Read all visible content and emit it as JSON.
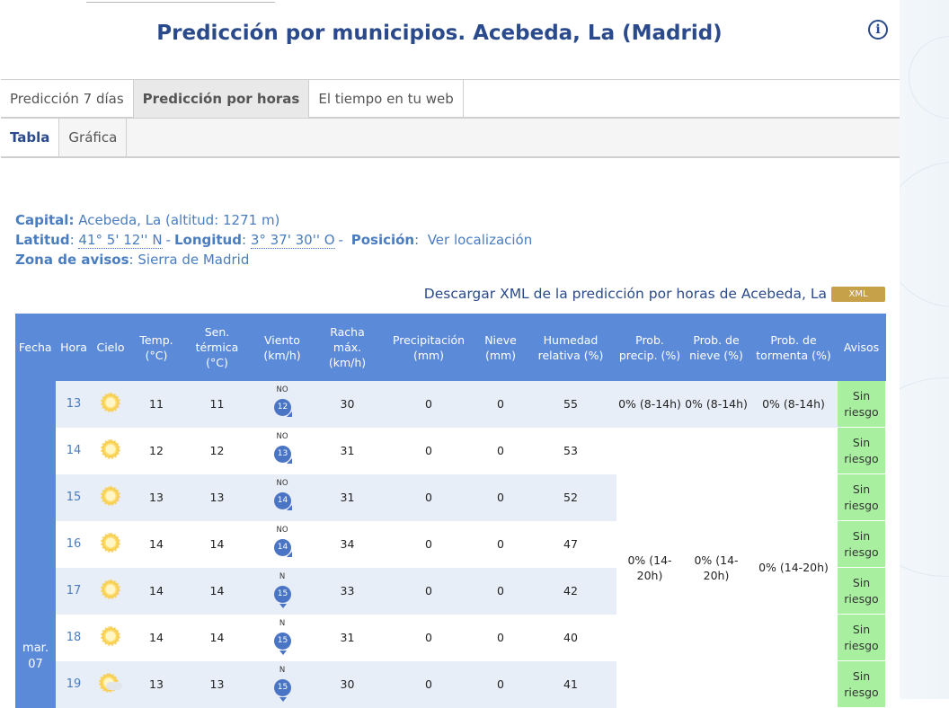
{
  "header": {
    "title": "Predicción por municipios. Acebeda, La (Madrid)"
  },
  "tabs": [
    "Predicción 7 días",
    "Predicción por horas",
    "El tiempo en tu web"
  ],
  "subtabs": [
    "Tabla",
    "Gráfica"
  ],
  "info": {
    "capital_label": "Capital:",
    "capital_value": " Acebeda, La (altitud: 1271 m)",
    "latitud_label": "Latitud",
    "latitud_value": "41° 5' 12'' N",
    "longitud_label": "Longitud",
    "longitud_value": "3° 37' 30'' O",
    "posicion_label": "Posición",
    "posicion_link": "Ver localización",
    "zona_label": "Zona de avisos",
    "zona_value": "Sierra de Madrid"
  },
  "download": {
    "text": "Descargar XML de la predicción por horas de Acebeda, La",
    "badge": "XML"
  },
  "table": {
    "headers": {
      "fecha": "Fecha",
      "hora": "Hora",
      "cielo": "Cielo",
      "temp": "Temp. (°C)",
      "sen": "Sen. térmica (°C)",
      "viento": "Viento (km/h)",
      "racha": "Racha máx. (km/h)",
      "precip": "Precipitación (mm)",
      "nieve": "Nieve (mm)",
      "humedad": "Humedad relativa (%)",
      "prob_precip": "Prob. precip. (%)",
      "prob_nieve": "Prob. de nieve (%)",
      "prob_tormenta": "Prob. de tormenta (%)",
      "avisos": "Avisos"
    },
    "fecha": "mar. 07",
    "rows": [
      {
        "hora": "13",
        "cielo": "sun-icon",
        "temp": "11",
        "sen": "11",
        "wind_dir": "NO",
        "wind_speed": "12",
        "racha": "30",
        "precip": "0",
        "nieve": "0",
        "humedad": "55",
        "aviso": "Sin riesgo"
      },
      {
        "hora": "14",
        "cielo": "sun-icon",
        "temp": "12",
        "sen": "12",
        "wind_dir": "NO",
        "wind_speed": "13",
        "racha": "31",
        "precip": "0",
        "nieve": "0",
        "humedad": "53",
        "aviso": "Sin riesgo"
      },
      {
        "hora": "15",
        "cielo": "sun-icon",
        "temp": "13",
        "sen": "13",
        "wind_dir": "NO",
        "wind_speed": "14",
        "racha": "31",
        "precip": "0",
        "nieve": "0",
        "humedad": "52",
        "aviso": "Sin riesgo"
      },
      {
        "hora": "16",
        "cielo": "sun-icon",
        "temp": "14",
        "sen": "14",
        "wind_dir": "NO",
        "wind_speed": "14",
        "racha": "34",
        "precip": "0",
        "nieve": "0",
        "humedad": "47",
        "aviso": "Sin riesgo"
      },
      {
        "hora": "17",
        "cielo": "sun-icon",
        "temp": "14",
        "sen": "14",
        "wind_dir": "N",
        "wind_speed": "15",
        "racha": "33",
        "precip": "0",
        "nieve": "0",
        "humedad": "42",
        "aviso": "Sin riesgo"
      },
      {
        "hora": "18",
        "cielo": "sun-icon",
        "temp": "14",
        "sen": "14",
        "wind_dir": "N",
        "wind_speed": "15",
        "racha": "31",
        "precip": "0",
        "nieve": "0",
        "humedad": "40",
        "aviso": "Sin riesgo"
      },
      {
        "hora": "19",
        "cielo": "partly-cloudy-icon",
        "temp": "13",
        "sen": "13",
        "wind_dir": "N",
        "wind_speed": "15",
        "racha": "30",
        "precip": "0",
        "nieve": "0",
        "humedad": "41",
        "aviso": "Sin riesgo"
      }
    ],
    "prob_first": {
      "precip": "0% (8-14h)",
      "nieve": "0% (8-14h)",
      "tormenta": "0% (8-14h)"
    },
    "prob_second": {
      "precip": "0% (14-20h)",
      "nieve": "0% (14-20h)",
      "tormenta": "0% (14-20h)"
    }
  },
  "colors": {
    "title": "#2a4a8c",
    "header_bg": "#5b8ad8",
    "row_alt": "#e8eef7",
    "aviso_green": "#a8f0a0",
    "xml_badge": "#c7a14a"
  }
}
